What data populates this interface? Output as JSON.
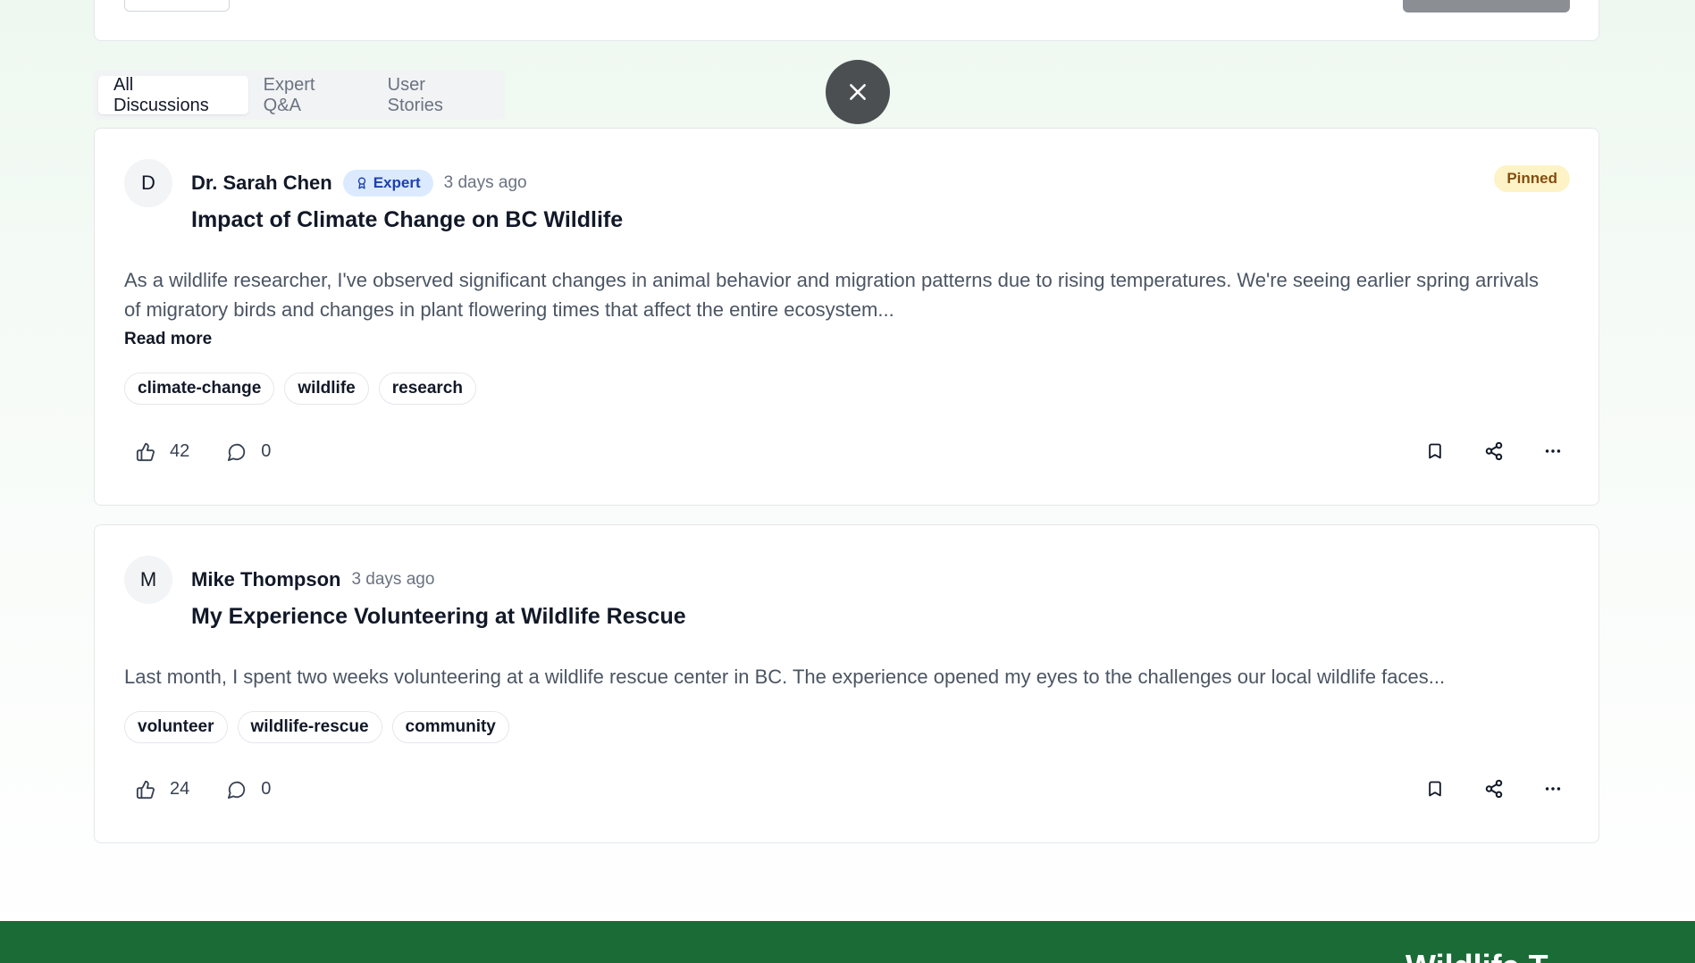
{
  "tabs": [
    {
      "label": "All Discussions",
      "active": true
    },
    {
      "label": "Expert Q&A",
      "active": false
    },
    {
      "label": "User Stories",
      "active": false
    }
  ],
  "posts": [
    {
      "avatar_initial": "D",
      "author": "Dr. Sarah Chen",
      "badge": "Expert",
      "time": "3 days ago",
      "pinned_label": "Pinned",
      "title": "Impact of Climate Change on BC Wildlife",
      "excerpt": "As a wildlife researcher, I've observed significant changes in animal behavior and migration patterns due to rising temperatures. We're seeing earlier spring arrivals of migratory birds and changes in plant flowering times that affect the entire ecosystem...",
      "read_more": "Read more",
      "tags": [
        "climate-change",
        "wildlife",
        "research"
      ],
      "likes": "42",
      "comments": "0"
    },
    {
      "avatar_initial": "M",
      "author": "Mike Thompson",
      "time": "3 days ago",
      "title": "My Experience Volunteering at Wildlife Rescue",
      "excerpt": "Last month, I spent two weeks volunteering at a wildlife rescue center in BC. The experience opened my eyes to the challenges our local wildlife faces...",
      "tags": [
        "volunteer",
        "wildlife-rescue",
        "community"
      ],
      "likes": "24",
      "comments": "0"
    }
  ],
  "footer": {
    "text": "Wildlife T"
  },
  "icons": {
    "close": "close-icon",
    "expert": "award-icon",
    "like": "thumbs-up-icon",
    "comment": "comment-icon",
    "bookmark": "bookmark-icon",
    "share": "share-icon",
    "more": "more-horizontal-icon"
  },
  "colors": {
    "footer": "#1b6b37",
    "expert_badge_bg": "#dbeafe",
    "pinned_bg": "#fef3c7",
    "fab": "#4b4f52"
  }
}
